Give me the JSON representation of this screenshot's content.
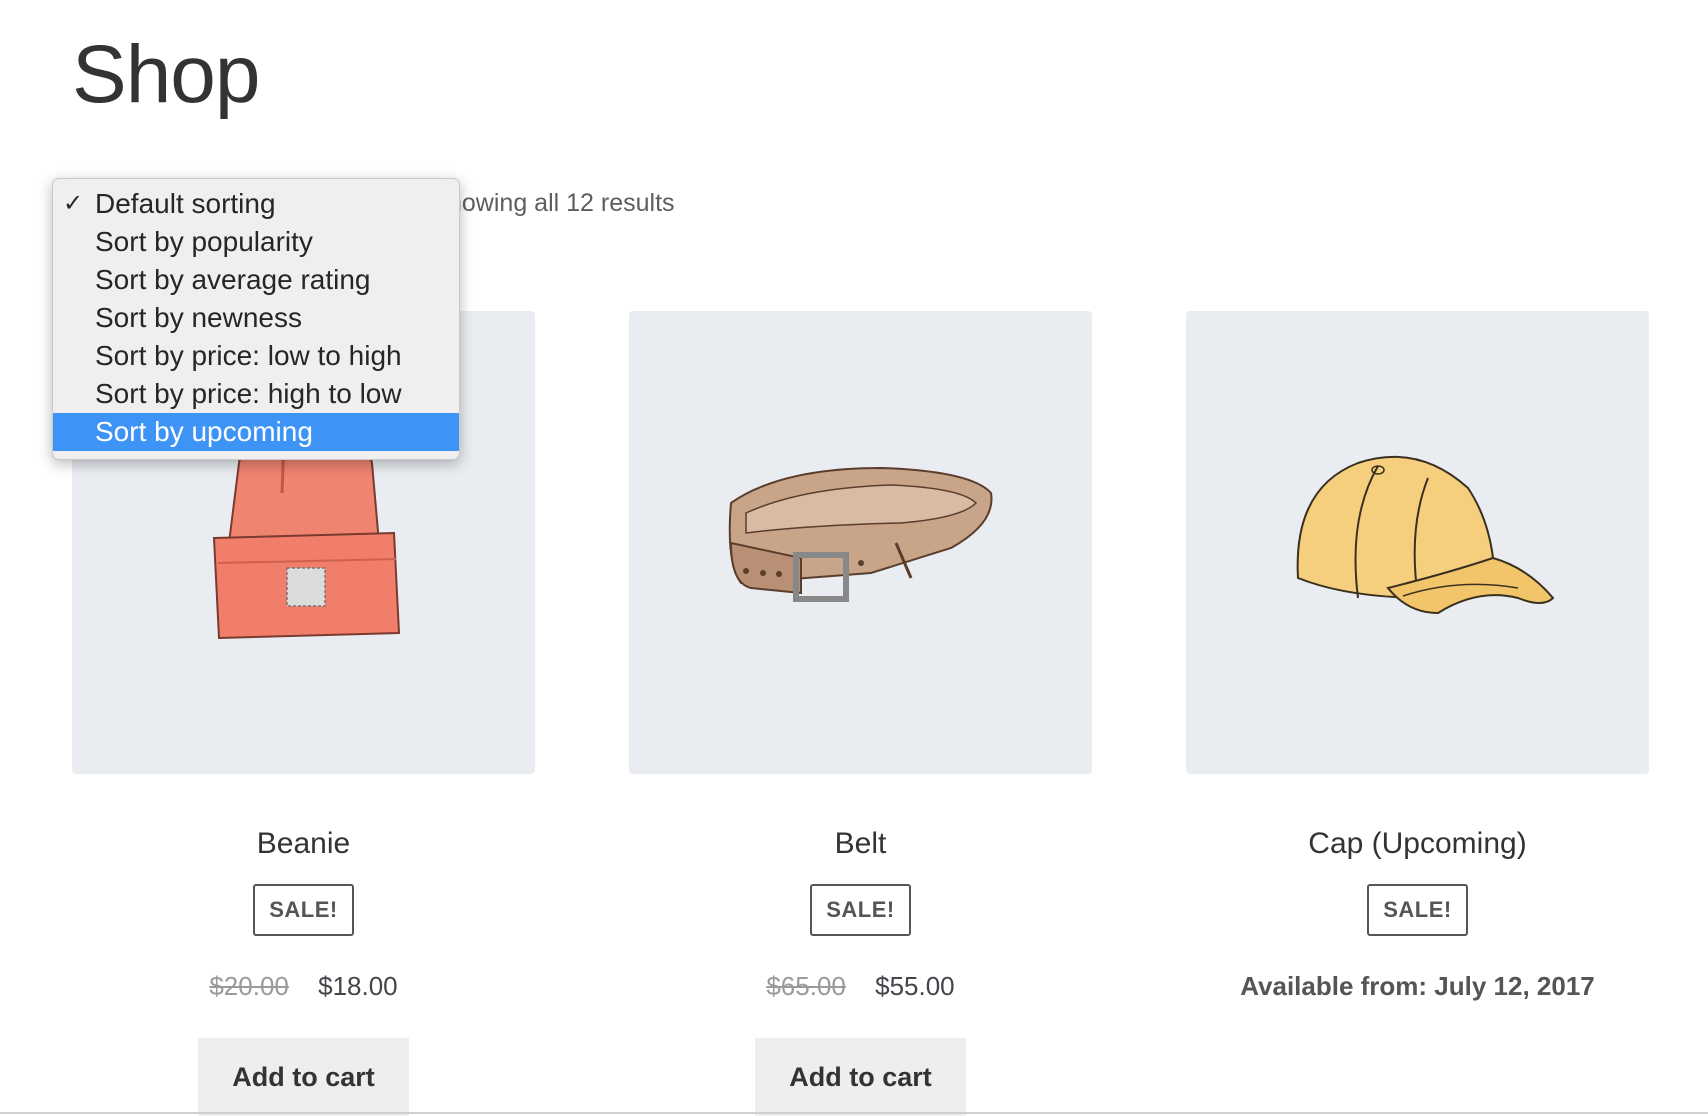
{
  "page": {
    "title": "Shop"
  },
  "result_count": "howing all 12 results",
  "sort_menu": {
    "options": [
      "Default sorting",
      "Sort by popularity",
      "Sort by average rating",
      "Sort by newness",
      "Sort by price: low to high",
      "Sort by price: high to low",
      "Sort by upcoming"
    ],
    "checked_index": 0,
    "highlighted_index": 6,
    "check_glyph": "✓"
  },
  "products": [
    {
      "name": "Beanie",
      "badge": "SALE!",
      "old_price": "$20.00",
      "price": "$18.00",
      "button": "Add to cart",
      "icon": "beanie-icon"
    },
    {
      "name": "Belt",
      "badge": "SALE!",
      "old_price": "$65.00",
      "price": "$55.00",
      "button": "Add to cart",
      "icon": "belt-icon"
    },
    {
      "name": "Cap (Upcoming)",
      "badge": "SALE!",
      "availability": "Available from: July 12, 2017",
      "icon": "cap-icon"
    }
  ],
  "colors": {
    "highlight": "#3d94f6",
    "image_bg": "#e9edf1",
    "button_bg": "#eeeeee"
  }
}
